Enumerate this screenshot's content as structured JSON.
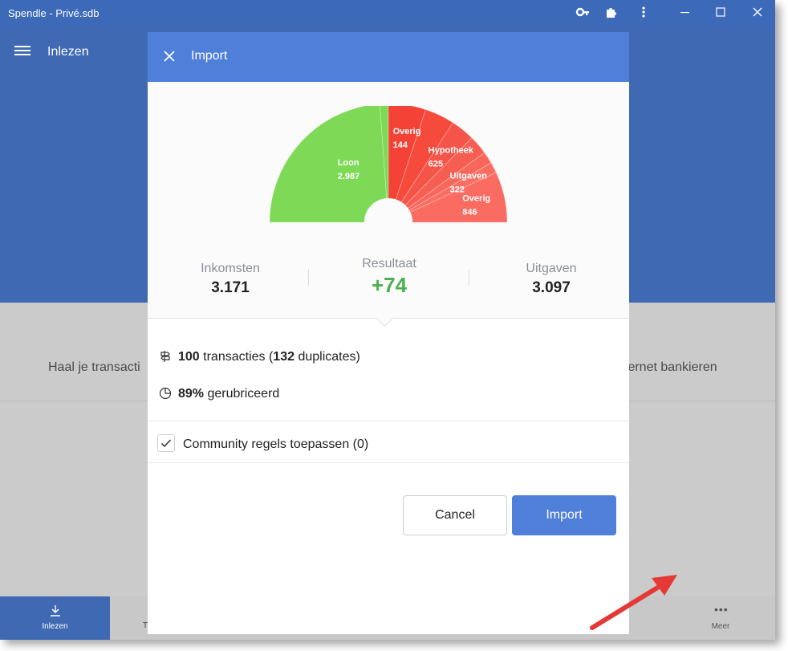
{
  "window": {
    "title": "Spendle - Privé.sdb"
  },
  "appbar": {
    "title": "Inlezen"
  },
  "background": {
    "text_left": "Haal je transacti",
    "text_right": "ternet bankieren"
  },
  "bottom_nav": {
    "active_label": "Inlezen",
    "partial_left": "T",
    "partial_right": "",
    "more_label": "Meer"
  },
  "dialog": {
    "title": "Import",
    "stats": {
      "income_label": "Inkomsten",
      "income_value": "3.171",
      "result_label": "Resultaat",
      "result_value": "+74",
      "expenses_label": "Uitgaven",
      "expenses_value": "3.097"
    },
    "transactions": {
      "count": "100",
      "text1": " transacties (",
      "duplicates": "132",
      "text2": " duplicates)"
    },
    "categorized": {
      "percent": "89%",
      "text": " gerubriceerd"
    },
    "community_rules": {
      "label": "Community regels toepassen (0)",
      "checked": true
    },
    "buttons": {
      "cancel": "Cancel",
      "import": "Import"
    }
  },
  "colors": {
    "titlebar": "#3c69b8",
    "appbar": "#3f6ab3",
    "dialog_header": "#4f7fd8",
    "income_green": "#7ed957",
    "expense_red": "#f44336",
    "result_green": "#4caf50",
    "annotation_arrow": "#e53935"
  },
  "chart_data": {
    "type": "pie",
    "subtype": "half-donut",
    "left_half": [
      {
        "name": "Loon",
        "value_label": "2.987",
        "value": 2987,
        "color": "#7ed957"
      },
      {
        "name": "Overig",
        "value_label": "144",
        "value": 144,
        "color": "#7ed957"
      }
    ],
    "right_half": [
      {
        "name": "Hypotheek",
        "value_label": "625",
        "value": 625,
        "color": "#f44336"
      },
      {
        "name": "",
        "value": 500,
        "color": "#f54a3c"
      },
      {
        "name": "",
        "value": 400,
        "color": "#f55448"
      },
      {
        "name": "Uitgaven",
        "value_label": "322",
        "value": 322,
        "color": "#f65e52"
      },
      {
        "name": "",
        "value": 200,
        "color": "#f7675b"
      },
      {
        "name": "",
        "value": 180,
        "color": "#f86e62"
      },
      {
        "name": "Overig",
        "value_label": "846",
        "value": 846,
        "color": "#fa6b62"
      }
    ]
  }
}
